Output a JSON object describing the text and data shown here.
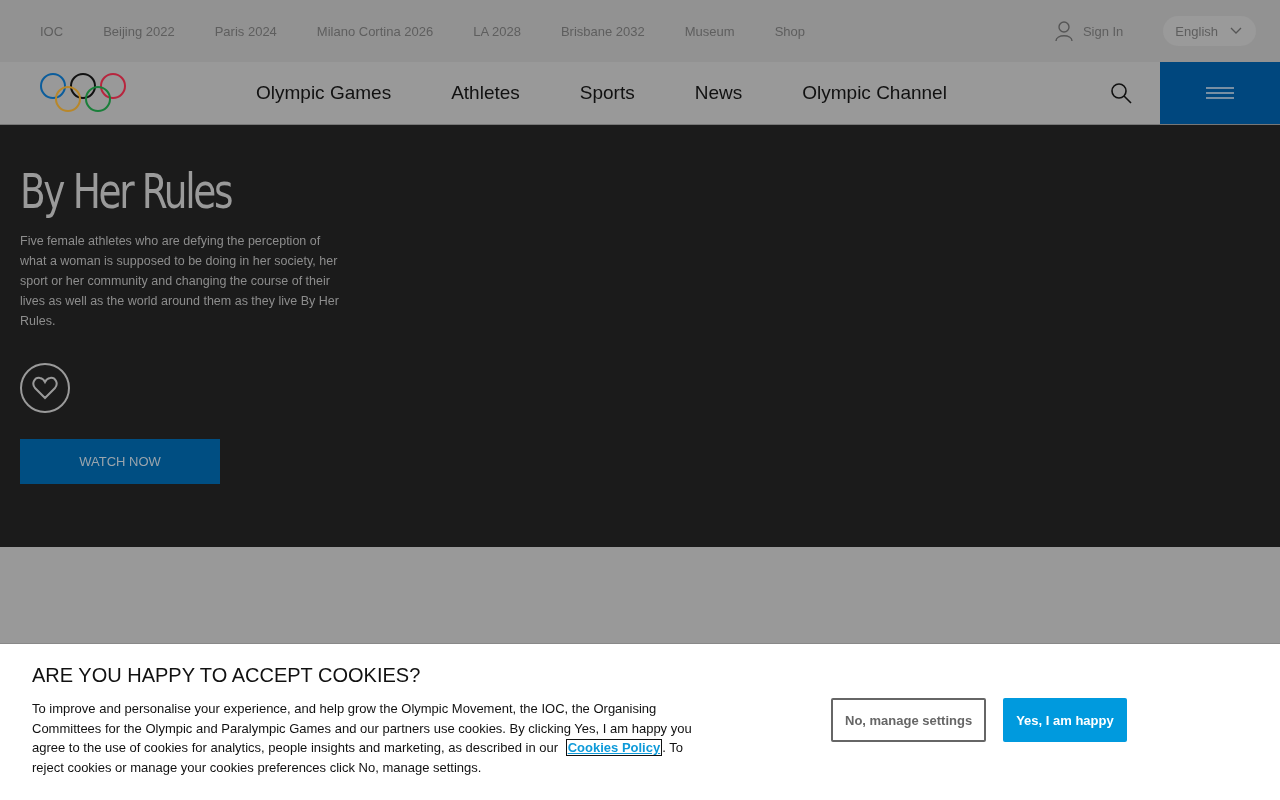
{
  "top_links": [
    "IOC",
    "Beijing 2022",
    "Paris 2024",
    "Milano Cortina 2026",
    "LA 2028",
    "Brisbane 2032",
    "Museum",
    "Shop"
  ],
  "sign_in": "Sign In",
  "language": "English",
  "nav": [
    "Olympic Games",
    "Athletes",
    "Sports",
    "News",
    "Olympic Channel"
  ],
  "hero": {
    "title": "By Her Rules",
    "description": "Five female athletes who are defying the perception of what a woman is supposed to be doing in her society, her sport or her community and changing the course of their lives as well as the world around them as they live By Her Rules.",
    "favourite": false,
    "button": "WATCH NOW"
  },
  "cookies": {
    "title": "ARE YOU HAPPY TO ACCEPT COOKIES?",
    "text_before": "To improve and personalise your experience, and help grow the Olympic Movement, the IOC, the Organising Committees for the Olympic and Paralympic Games and our partners use cookies. By clicking Yes, I am happy you agree to the use of cookies for analytics, people insights and marketing, as described in our",
    "link": "Cookies Policy",
    "text_after": ". To reject cookies or manage your cookies preferences click No, manage settings.",
    "decline": "No, manage settings",
    "accept": "Yes, I am happy"
  }
}
